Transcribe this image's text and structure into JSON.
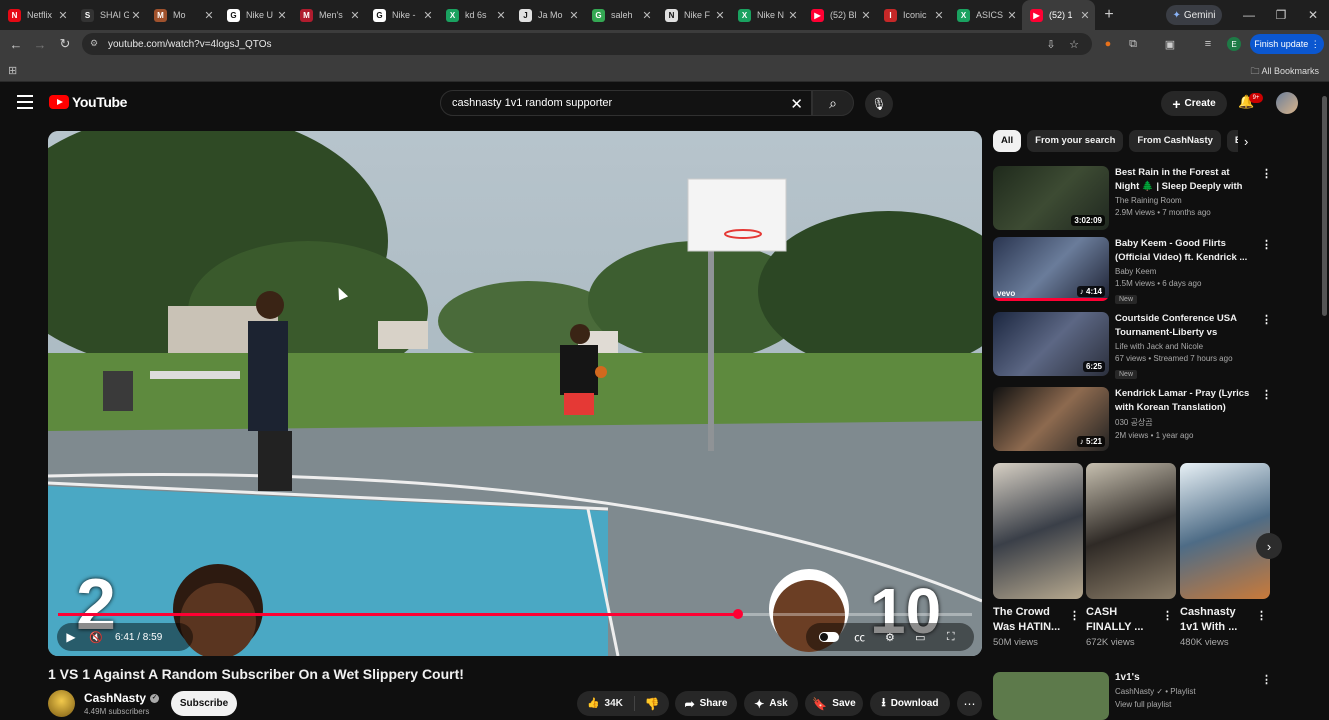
{
  "browser": {
    "tabs": [
      {
        "title": "Netflix",
        "color": "#e50914",
        "glyph": "N"
      },
      {
        "title": "SHAI G",
        "color": "#333333",
        "glyph": "S"
      },
      {
        "title": "Mo",
        "color": "#a0522d",
        "glyph": "M"
      },
      {
        "title": "Nike U",
        "color": "#ffffff",
        "glyph": "G"
      },
      {
        "title": "Men's",
        "color": "#b01c2e",
        "glyph": "M"
      },
      {
        "title": "Nike -",
        "color": "#ffffff",
        "glyph": "G"
      },
      {
        "title": "kd 6s",
        "color": "#1aa260",
        "glyph": "X"
      },
      {
        "title": "Ja Mo",
        "color": "#e0e0e0",
        "glyph": "J"
      },
      {
        "title": "saleh",
        "color": "#34a853",
        "glyph": "G"
      },
      {
        "title": "Nike F",
        "color": "#e0e0e0",
        "glyph": "N"
      },
      {
        "title": "Nike N",
        "color": "#1aa260",
        "glyph": "X"
      },
      {
        "title": "(52) Bl",
        "color": "#ff0033",
        "glyph": "▶"
      },
      {
        "title": "Iconic",
        "color": "#c62828",
        "glyph": "I"
      },
      {
        "title": "ASICS",
        "color": "#1aa260",
        "glyph": "X"
      },
      {
        "title": "(52) 1",
        "color": "#ff0033",
        "glyph": "▶"
      }
    ],
    "active_tab_index": 14,
    "gemini_label": "Gemini",
    "url": "youtube.com/watch?v=4logsJ_QTOs",
    "finish_update_label": "Finish update",
    "profile_initial": "E",
    "all_bookmarks_label": "All Bookmarks"
  },
  "youtube": {
    "logo_text": "YouTube",
    "search_query": "cashnasty 1v1 random supporter",
    "create_label": "Create",
    "notification_badge": "9+"
  },
  "player": {
    "current_time": "6:41",
    "duration": "8:59",
    "time_display": "6:41 / 8:59",
    "progress_fraction": 0.744,
    "score_left": "2",
    "score_right": "10"
  },
  "video": {
    "title": "1 VS 1 Against A Random Subscriber On a Wet Slippery Court!",
    "channel_name": "CashNasty",
    "subscribers": "4.49M subscribers",
    "subscribe_label": "Subscribe",
    "likes": "34K",
    "share_label": "Share",
    "ask_label": "Ask",
    "save_label": "Save",
    "download_label": "Download"
  },
  "chips": [
    "All",
    "From your search",
    "From CashNasty",
    "B"
  ],
  "recommendations": [
    {
      "title": "Best Rain in the Forest at Night 🌲 | Sleep Deeply with Rain ...",
      "channel": "The Raining Room",
      "meta": "2.9M views • 7 months ago",
      "duration": "3:02:09",
      "badge": "",
      "watched": 0.0
    },
    {
      "title": "Baby Keem - Good Flirts (Official Video) ft. Kendrick ...",
      "channel": "Baby Keem",
      "meta": "1.5M views • 6 days ago",
      "duration": "♪ 4:14",
      "badge": "New",
      "watched": 1.0,
      "overlay": "vevo"
    },
    {
      "title": "Courtside Conference USA Tournament-Liberty vs Missou...",
      "channel": "Life with Jack and Nicole",
      "meta": "67 views • Streamed 7 hours ago",
      "duration": "6:25",
      "badge": "New",
      "watched": 0.0
    },
    {
      "title": "Kendrick Lamar - Pray (Lyrics with Korean Translation)",
      "channel": "030 공상곰",
      "meta": "2M views • 1 year ago",
      "duration": "♪ 5:21",
      "badge": "",
      "watched": 0.0
    }
  ],
  "shorts": [
    {
      "title": "The Crowd Was HATIN...",
      "views": "50M views"
    },
    {
      "title": "CASH FINALLY ...",
      "views": "672K views"
    },
    {
      "title": "Cashnasty 1v1 With ...",
      "views": "480K views"
    }
  ],
  "playlist": {
    "title": "1v1's",
    "channel": "CashNasty",
    "type": "Playlist",
    "link": "View full playlist"
  }
}
